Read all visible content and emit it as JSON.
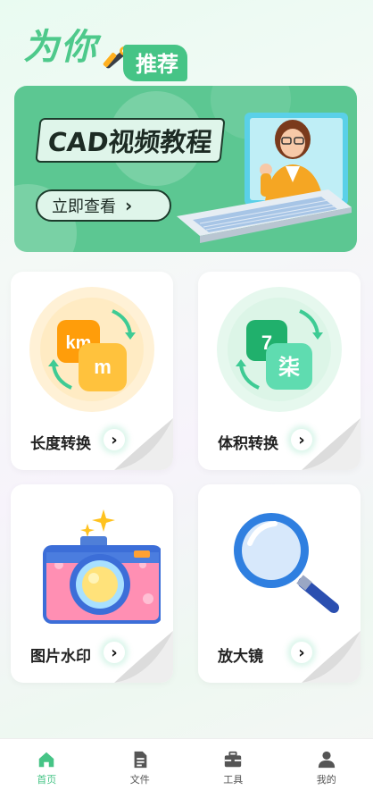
{
  "header": {
    "title": "为你",
    "badge": "推荐"
  },
  "banner": {
    "title": "CAD视频教程",
    "button_label": "立即查看"
  },
  "cards": [
    {
      "label": "长度转换",
      "icon": "length-convert-icon",
      "glyph_a": "km",
      "glyph_b": "m"
    },
    {
      "label": "体积转换",
      "icon": "volume-convert-icon",
      "glyph_a": "7",
      "glyph_b": "柒"
    },
    {
      "label": "图片水印",
      "icon": "camera-icon"
    },
    {
      "label": "放大镜",
      "icon": "magnifier-icon"
    }
  ],
  "tabbar": {
    "items": [
      {
        "label": "首页",
        "icon": "home-icon",
        "active": true
      },
      {
        "label": "文件",
        "icon": "file-icon",
        "active": false
      },
      {
        "label": "工具",
        "icon": "toolbox-icon",
        "active": false
      },
      {
        "label": "我的",
        "icon": "profile-icon",
        "active": false
      }
    ]
  },
  "colors": {
    "brand_green": "#46c486",
    "banner_bg": "#5cc792",
    "orange": "#ffb01f",
    "teal": "#3ecb94"
  }
}
